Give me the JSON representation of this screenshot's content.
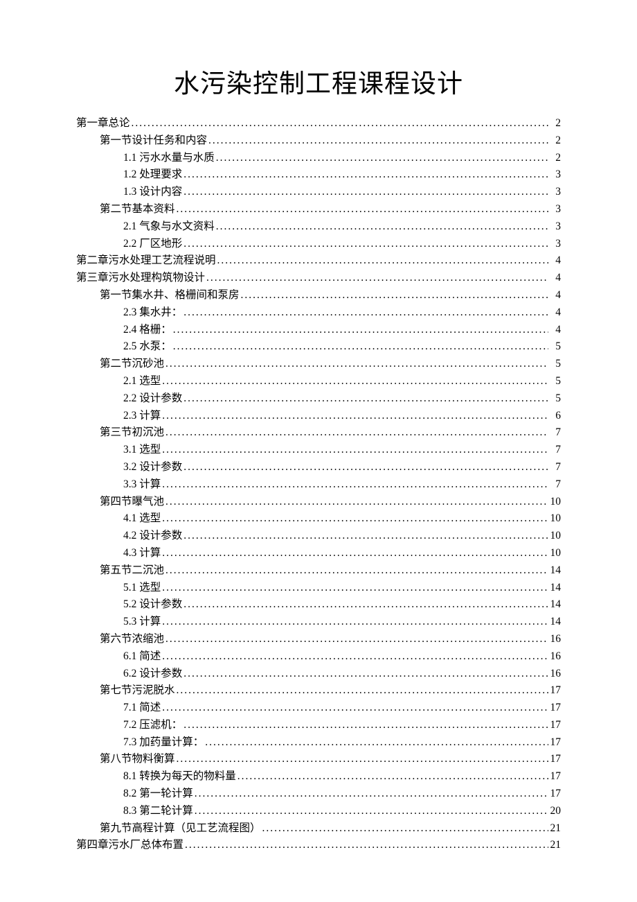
{
  "title": "水污染控制工程课程设计",
  "toc": [
    {
      "level": 0,
      "label": "第一章总论",
      "page": "2"
    },
    {
      "level": 1,
      "label": "第一节设计任务和内容",
      "page": "2"
    },
    {
      "level": 2,
      "label": "1.1  污水水量与水质",
      "page": "2"
    },
    {
      "level": 2,
      "label": "1.2  处理要求",
      "page": "3"
    },
    {
      "level": 2,
      "label": "1.3  设计内容",
      "page": "3"
    },
    {
      "level": 1,
      "label": "第二节基本资料",
      "page": "3"
    },
    {
      "level": 2,
      "label": "2.1  气象与水文资料",
      "page": "3"
    },
    {
      "level": 2,
      "label": "2.2  厂区地形",
      "page": "3"
    },
    {
      "level": 0,
      "label": "第二章污水处理工艺流程说明",
      "page": "4"
    },
    {
      "level": 0,
      "label": "第三章污水处理构筑物设计",
      "page": "4"
    },
    {
      "level": 1,
      "label": "第一节集水井、格栅间和泵房",
      "page": "4"
    },
    {
      "level": 2,
      "label": "2.3  集水井：",
      "page": "4"
    },
    {
      "level": 2,
      "label": "2.4  格栅：",
      "page": "4"
    },
    {
      "level": 2,
      "label": "2.5  水泵：",
      "page": "5"
    },
    {
      "level": 1,
      "label": "第二节沉砂池",
      "page": "5"
    },
    {
      "level": 2,
      "label": "2.1  选型",
      "page": "5"
    },
    {
      "level": 2,
      "label": "2.2  设计参数",
      "page": "5"
    },
    {
      "level": 2,
      "label": "2.3  计算",
      "page": "6"
    },
    {
      "level": 1,
      "label": "第三节初沉池",
      "page": "7"
    },
    {
      "level": 2,
      "label": "3.1  选型",
      "page": "7"
    },
    {
      "level": 2,
      "label": "3.2  设计参数",
      "page": "7"
    },
    {
      "level": 2,
      "label": "3.3  计算",
      "page": "7"
    },
    {
      "level": 1,
      "label": "第四节曝气池",
      "page": "10"
    },
    {
      "level": 2,
      "label": "4.1  选型",
      "page": "10"
    },
    {
      "level": 2,
      "label": "4.2  设计参数",
      "page": "10"
    },
    {
      "level": 2,
      "label": "4.3  计算",
      "page": "10"
    },
    {
      "level": 1,
      "label": "第五节二沉池",
      "page": "14"
    },
    {
      "level": 2,
      "label": "5.1  选型",
      "page": "14"
    },
    {
      "level": 2,
      "label": "5.2  设计参数",
      "page": "14"
    },
    {
      "level": 2,
      "label": "5.3  计算",
      "page": "14"
    },
    {
      "level": 1,
      "label": "第六节浓缩池",
      "page": "16"
    },
    {
      "level": 2,
      "label": "6.1  简述",
      "page": "16"
    },
    {
      "level": 2,
      "label": "6.2  设计参数",
      "page": "16"
    },
    {
      "level": 1,
      "label": "第七节污泥脱水",
      "page": "17"
    },
    {
      "level": 2,
      "label": "7.1  简述",
      "page": "17"
    },
    {
      "level": 2,
      "label": "7.2  压滤机：",
      "page": "17"
    },
    {
      "level": 2,
      "label": "7.3  加药量计算：",
      "page": "17"
    },
    {
      "level": 1,
      "label": "第八节物料衡算",
      "page": "17"
    },
    {
      "level": 2,
      "label": "8.1  转换为每天的物料量",
      "page": "17"
    },
    {
      "level": 2,
      "label": "8.2  第一轮计算",
      "page": "17"
    },
    {
      "level": 2,
      "label": "8.3  第二轮计算",
      "page": "20"
    },
    {
      "level": 1,
      "label": "第九节高程计算（见工艺流程图）",
      "page": "21"
    },
    {
      "level": 0,
      "label": "第四章污水厂总体布置",
      "page": "21"
    }
  ]
}
